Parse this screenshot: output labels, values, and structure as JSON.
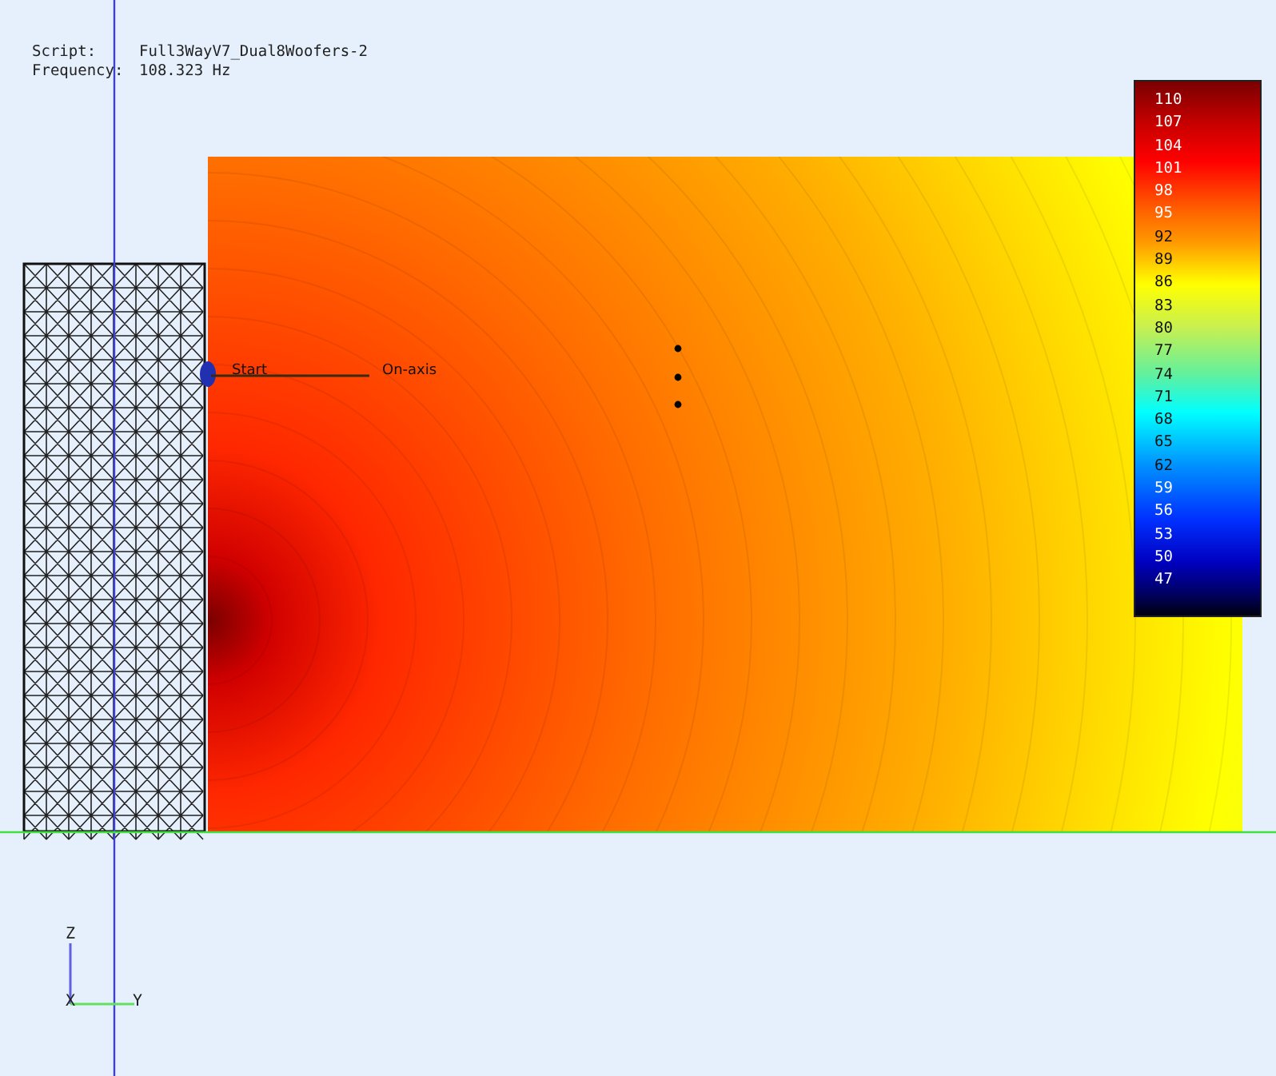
{
  "info": [
    {
      "label": "Script:",
      "value": "Full3WayV7_Dual8Woofers-2"
    },
    {
      "label": "Frequency:",
      "value": "108.323 Hz"
    }
  ],
  "probe": {
    "start_label": "Start",
    "end_label": "On-axis"
  },
  "legend": {
    "labels": [
      "110",
      "107",
      "104",
      "101",
      "98",
      "95",
      "92",
      "89",
      "86",
      "83",
      "80",
      "77",
      "74",
      "71",
      "68",
      "65",
      "62",
      "59",
      "56",
      "53",
      "50",
      "47"
    ]
  },
  "axes": {
    "z": "Z",
    "x": "X",
    "y": "Y"
  }
}
